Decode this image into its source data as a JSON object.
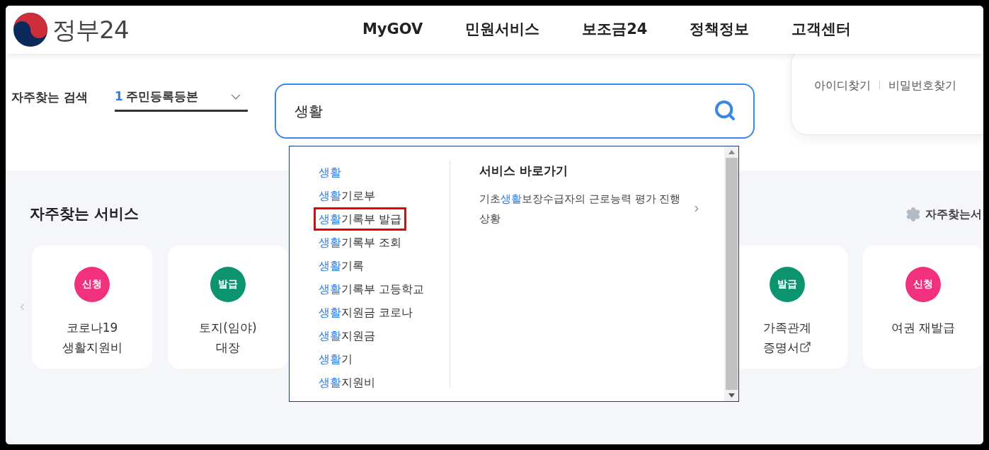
{
  "header": {
    "logo_text": "정부24",
    "nav": [
      {
        "label": "MyGOV"
      },
      {
        "label": "민원서비스"
      },
      {
        "label": "보조금24"
      },
      {
        "label": "정책정보"
      },
      {
        "label": "고객센터"
      }
    ]
  },
  "login_links": [
    "아이디찾기",
    "비밀번호찾기"
  ],
  "frequent_search": {
    "label": "자주찾는 검색",
    "rank": "1",
    "value": "주민등록등본"
  },
  "search": {
    "value": "생활"
  },
  "suggestions": [
    {
      "highlight": "생활",
      "selected": false
    },
    {
      "highlight": "생활",
      "text": "기로부",
      "selected": false
    },
    {
      "highlight": "생활",
      "text": "기록부 발급",
      "selected": true
    },
    {
      "highlight": "생활",
      "text": "기록부 조회",
      "selected": false
    },
    {
      "highlight": "생활",
      "text": "기록",
      "selected": false
    },
    {
      "highlight": "생활",
      "text": "기록부 고등학교",
      "selected": false
    },
    {
      "highlight": "생활",
      "text": "지원금 코로나",
      "selected": false
    },
    {
      "highlight": "생활",
      "text": "지원금",
      "selected": false
    },
    {
      "highlight": "생활",
      "text": "기",
      "selected": false
    },
    {
      "highlight": "생활",
      "text": "지원비",
      "selected": false
    }
  ],
  "shortcuts": {
    "title": "서비스 바로가기",
    "items": [
      {
        "before": "기초",
        "highlight": "생활",
        "after": "보장수급자의 근로능력 평가 진행상황"
      }
    ]
  },
  "services": {
    "title": "자주찾는 서비스",
    "settings_label": "자주찾는서",
    "cards_left": [
      {
        "badge": "신청",
        "color": "#f1317e",
        "lines": [
          "코로나19",
          "생활지원비"
        ],
        "external": false
      },
      {
        "badge": "발급",
        "color": "#0c9370",
        "lines": [
          "토지(임야)",
          "대장"
        ],
        "external": false
      }
    ],
    "cards_right": [
      {
        "badge": "발급",
        "color": "#0c9370",
        "lines": [
          "가족관계",
          "증명서"
        ],
        "external": true
      },
      {
        "badge": "신청",
        "color": "#f1317e",
        "lines": [
          "여권 재발급"
        ],
        "external": false
      }
    ]
  }
}
